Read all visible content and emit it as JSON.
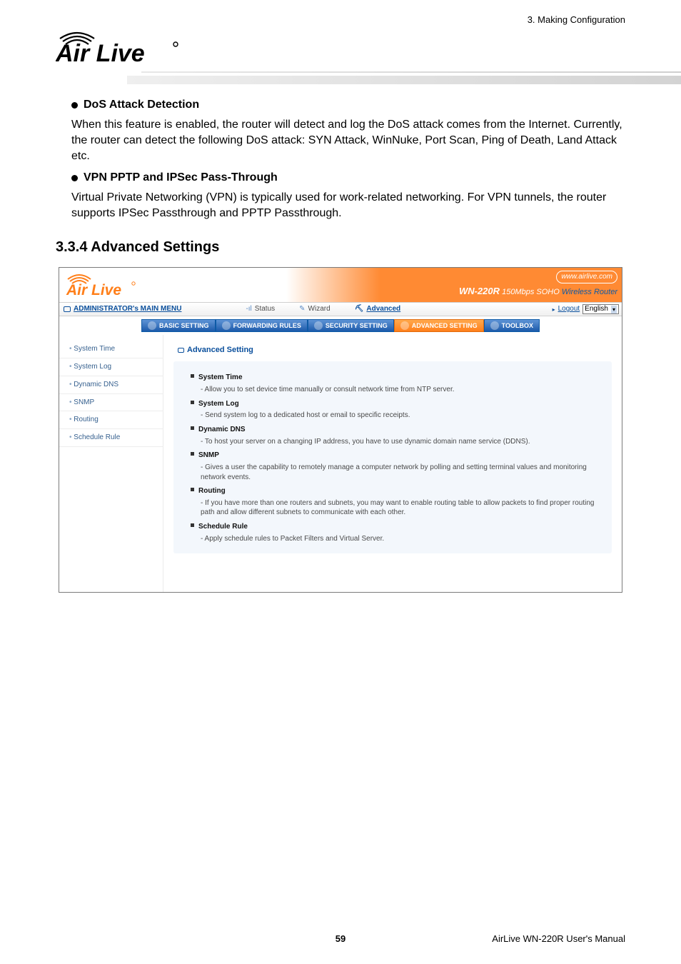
{
  "doc": {
    "top_right": "3. Making Configuration",
    "headings": {
      "h1": "DoS Attack Detection",
      "h2": "VPN PPTP and IPSec Pass-Through",
      "section": "3.3.4 Advanced Settings"
    },
    "paragraphs": {
      "p1": "When this feature is enabled, the router will detect and log the DoS attack comes from the Internet. Currently, the router can detect the following DoS attack: SYN Attack, WinNuke, Port Scan, Ping of Death, Land Attack etc.",
      "p2": "Virtual Private Networking (VPN) is typically used for work-related networking. For VPN tunnels, the router supports IPSec Passthrough and PPTP Passthrough."
    },
    "footer": {
      "page_number": "59",
      "manual": "AirLive WN-220R User's Manual"
    }
  },
  "shot": {
    "brand_url": "www.airlive.com",
    "model_bold": "WN-220R",
    "model_rest": " 150Mbps SOHO ",
    "model_tag": "Wireless Router",
    "main_menu_label": "ADMINISTRATOR's MAIN MENU",
    "mid_items": {
      "status": "Status",
      "wizard": "Wizard",
      "advanced": "Advanced"
    },
    "logout": "Logout",
    "language_selected": "English",
    "tabs": {
      "basic": "BASIC SETTING",
      "forward": "FORWARDING RULES",
      "security": "SECURITY SETTING",
      "advanced": "ADVANCED SETTING",
      "toolbox": "TOOLBOX"
    },
    "side": {
      "i0": "System Time",
      "i1": "System Log",
      "i2": "Dynamic DNS",
      "i3": "SNMP",
      "i4": "Routing",
      "i5": "Schedule Rule"
    },
    "panel": {
      "heading": "Advanced Setting",
      "items": {
        "a_title": "System Time",
        "a_desc": "- Allow you to set device time manually or consult network time from NTP server.",
        "b_title": "System Log",
        "b_desc": "- Send system log to a dedicated host or email to specific receipts.",
        "c_title": "Dynamic DNS",
        "c_desc": "- To host your server on a changing IP address, you have to use dynamic domain name service (DDNS).",
        "d_title": "SNMP",
        "d_desc": "- Gives a user the capability to remotely manage a computer network by polling and setting terminal values and monitoring network events.",
        "e_title": "Routing",
        "e_desc": "- If you have more than one routers and subnets, you may want to enable routing table to allow packets to find proper routing path and allow different subnets to communicate with each other.",
        "f_title": "Schedule Rule",
        "f_desc": "- Apply schedule rules to Packet Filters and Virtual Server."
      }
    }
  }
}
